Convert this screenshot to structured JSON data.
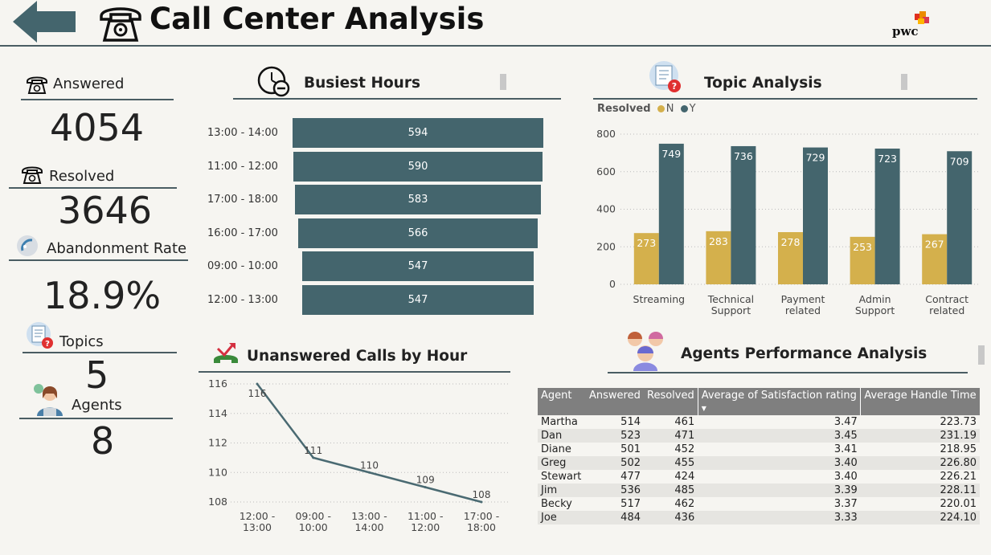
{
  "header": {
    "title": "Call Center Analysis",
    "logo_text": "pwc"
  },
  "kpis": {
    "answered": {
      "label": "Answered",
      "value": "4054"
    },
    "resolved": {
      "label": "Resolved",
      "value": "3646"
    },
    "abandonment": {
      "label": "Abandonment Rate",
      "value": "18.9%"
    },
    "topics": {
      "label": "Topics",
      "value": "5"
    },
    "agents": {
      "label": "Agents",
      "value": "8"
    }
  },
  "busiest_hours": {
    "title": "Busiest Hours",
    "rows": [
      {
        "label": "13:00 - 14:00",
        "value": 594
      },
      {
        "label": "11:00 - 12:00",
        "value": 590
      },
      {
        "label": "17:00 - 18:00",
        "value": 583
      },
      {
        "label": "16:00 - 17:00",
        "value": 566
      },
      {
        "label": "09:00 - 10:00",
        "value": 547
      },
      {
        "label": "12:00 - 13:00",
        "value": 547
      }
    ]
  },
  "topic_analysis": {
    "title": "Topic Analysis",
    "legend_title": "Resolved",
    "legend_n": "N",
    "legend_y": "Y"
  },
  "unanswered": {
    "title": "Unanswered Calls by Hour"
  },
  "agents_perf": {
    "title": "Agents Performance Analysis",
    "columns": [
      "Agent",
      "Answered",
      "Resolved",
      "Average of Satisfaction rating",
      "Average Handle Time"
    ],
    "sort_indicator": "▼",
    "rows": [
      [
        "Martha",
        "514",
        "461",
        "3.47",
        "223.73"
      ],
      [
        "Dan",
        "523",
        "471",
        "3.45",
        "231.19"
      ],
      [
        "Diane",
        "501",
        "452",
        "3.41",
        "218.95"
      ],
      [
        "Greg",
        "502",
        "455",
        "3.40",
        "226.80"
      ],
      [
        "Stewart",
        "477",
        "424",
        "3.40",
        "226.21"
      ],
      [
        "Jim",
        "536",
        "485",
        "3.39",
        "228.11"
      ],
      [
        "Becky",
        "517",
        "462",
        "3.37",
        "220.01"
      ],
      [
        "Joe",
        "484",
        "436",
        "3.33",
        "224.10"
      ]
    ]
  },
  "colors": {
    "teal": "#44656d",
    "gold": "#d4b04c",
    "line": "#4a6a72"
  },
  "chart_data": [
    {
      "type": "bar",
      "title": "Busiest Hours",
      "categories": [
        "13:00 - 14:00",
        "11:00 - 12:00",
        "17:00 - 18:00",
        "16:00 - 17:00",
        "09:00 - 10:00",
        "12:00 - 13:00"
      ],
      "values": [
        594,
        590,
        583,
        566,
        547,
        547
      ]
    },
    {
      "type": "bar",
      "title": "Topic Analysis",
      "categories": [
        "Streaming",
        "Technical Support",
        "Payment related",
        "Admin Support",
        "Contract related"
      ],
      "category_lines": [
        [
          "Streaming"
        ],
        [
          "Technical",
          "Support"
        ],
        [
          "Payment",
          "related"
        ],
        [
          "Admin",
          "Support"
        ],
        [
          "Contract",
          "related"
        ]
      ],
      "series": [
        {
          "name": "N",
          "values": [
            273,
            283,
            278,
            253,
            267
          ]
        },
        {
          "name": "Y",
          "values": [
            749,
            736,
            729,
            723,
            709
          ]
        }
      ],
      "ylim": [
        0,
        800
      ],
      "yticks": [
        0,
        200,
        400,
        600,
        800
      ],
      "grid": true,
      "legend": "top-left"
    },
    {
      "type": "line",
      "title": "Unanswered Calls by Hour",
      "categories": [
        "12:00 - 13:00",
        "09:00 - 10:00",
        "13:00 - 14:00",
        "11:00 - 12:00",
        "17:00 - 18:00"
      ],
      "category_lines": [
        [
          "12:00 -",
          "13:00"
        ],
        [
          "09:00 -",
          "10:00"
        ],
        [
          "13:00 -",
          "14:00"
        ],
        [
          "11:00 -",
          "12:00"
        ],
        [
          "17:00 -",
          "18:00"
        ]
      ],
      "values": [
        116,
        111,
        110,
        109,
        108
      ],
      "ylim": [
        108,
        116
      ],
      "yticks": [
        108,
        110,
        112,
        114,
        116
      ],
      "grid": true
    }
  ]
}
